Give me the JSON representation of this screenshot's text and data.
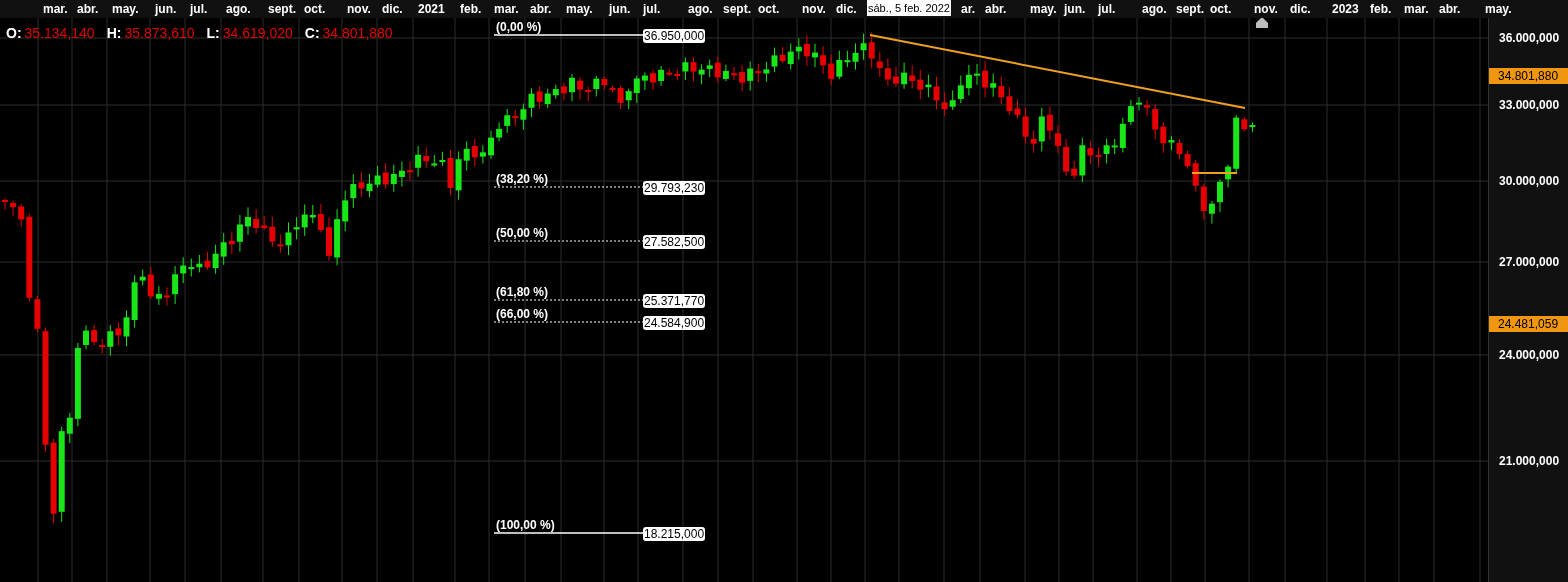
{
  "time_axis": {
    "labels": [
      {
        "text": "mar."
      },
      {
        "text": "abr."
      },
      {
        "text": "may."
      },
      {
        "text": "jun."
      },
      {
        "text": "jul."
      },
      {
        "text": "ago."
      },
      {
        "text": "sept."
      },
      {
        "text": "oct."
      },
      {
        "text": "nov."
      },
      {
        "text": "dic."
      },
      {
        "text": "2021"
      },
      {
        "text": "feb."
      },
      {
        "text": "mar."
      },
      {
        "text": "abr."
      },
      {
        "text": "may."
      },
      {
        "text": "jun."
      },
      {
        "text": "jul."
      },
      {
        "text": "ago."
      },
      {
        "text": "sept."
      },
      {
        "text": "oct."
      },
      {
        "text": "nov."
      },
      {
        "text": "dic."
      },
      {
        "text": "ar."
      },
      {
        "text": "abr."
      },
      {
        "text": "may."
      },
      {
        "text": "jun."
      },
      {
        "text": "jul."
      },
      {
        "text": "ago."
      },
      {
        "text": "sept."
      },
      {
        "text": "oct."
      },
      {
        "text": "nov."
      },
      {
        "text": "dic."
      },
      {
        "text": "2023"
      },
      {
        "text": "feb."
      },
      {
        "text": "mar."
      },
      {
        "text": "abr."
      },
      {
        "text": "may."
      }
    ],
    "hover_label": "sáb., 5 feb. 2022"
  },
  "ohlc": [
    {
      "label": "O:",
      "value": "35.134,140"
    },
    {
      "label": "H:",
      "value": "35.873,610"
    },
    {
      "label": "L:",
      "value": "34.619,020"
    },
    {
      "label": "C:",
      "value": "34.801,880"
    }
  ],
  "fibonacci": [
    {
      "percent": "(0,00 %)",
      "price": "36.950,000",
      "kind": "solid"
    },
    {
      "percent": "(38,20 %)",
      "price": "29.793,230",
      "kind": "dotted"
    },
    {
      "percent": "(50,00 %)",
      "price": "27.582,500",
      "kind": "dotted"
    },
    {
      "percent": "(61,80 %)",
      "price": "25.371,770",
      "kind": "dotted"
    },
    {
      "percent": "(66,00 %)",
      "price": "24.584,900",
      "kind": "dotted"
    },
    {
      "percent": "(100,00 %)",
      "price": "18.215,000",
      "kind": "solid"
    }
  ],
  "price_axis": {
    "ticks": [
      "36.000,000",
      "33.000,000",
      "30.000,000",
      "27.000,000",
      "24.000,000",
      "21.000,000"
    ],
    "markers": [
      "34.801,880",
      "24.481,059"
    ]
  }
}
